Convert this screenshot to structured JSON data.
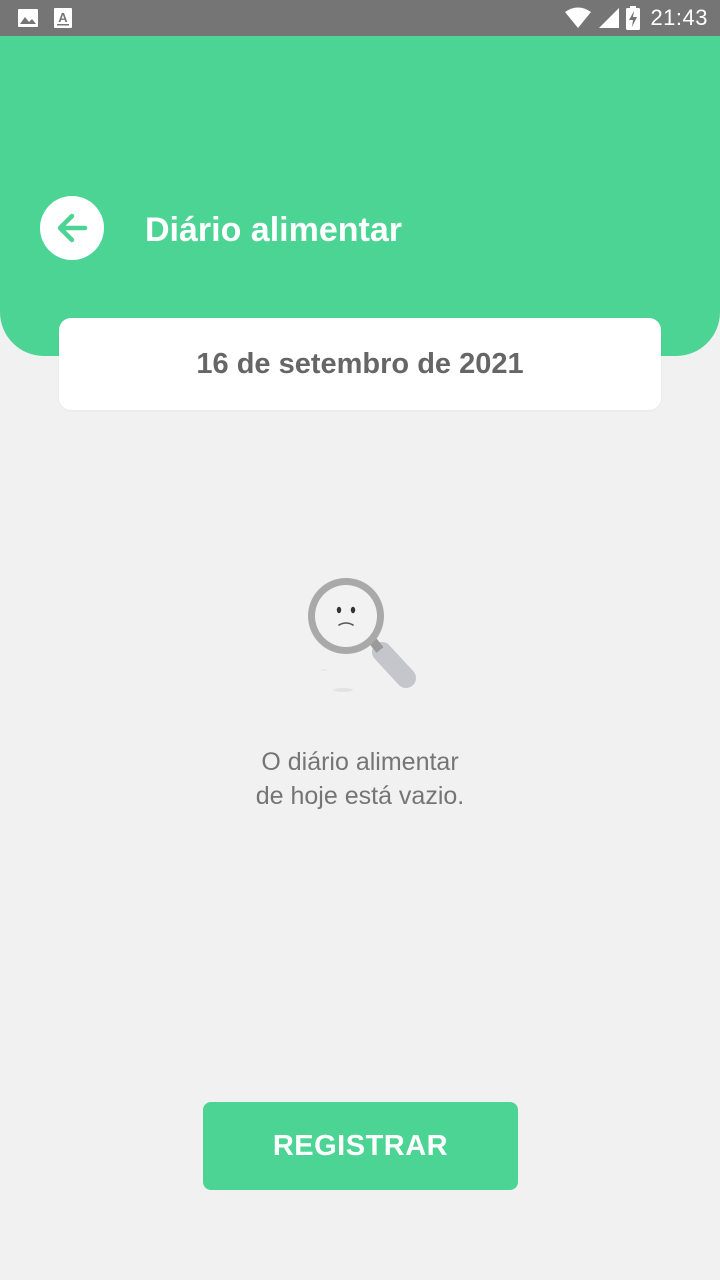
{
  "status_bar": {
    "time": "21:43",
    "icons": [
      "image-icon",
      "font-icon",
      "wifi-icon",
      "signal-icon",
      "battery-charging-icon"
    ]
  },
  "header": {
    "title": "Diário alimentar",
    "back_icon": "arrow-left-icon"
  },
  "date_card": {
    "date": "16 de setembro de 2021"
  },
  "empty_state": {
    "illustration": "sad-magnifying-glass-icon",
    "line1": "O diário alimentar",
    "line2": "de hoje está vazio."
  },
  "register_button": {
    "label": "REGISTRAR"
  },
  "colors": {
    "accent": "#4cd494",
    "background": "#f1f1f1",
    "status_bar": "#757575",
    "text_muted": "#757575"
  }
}
